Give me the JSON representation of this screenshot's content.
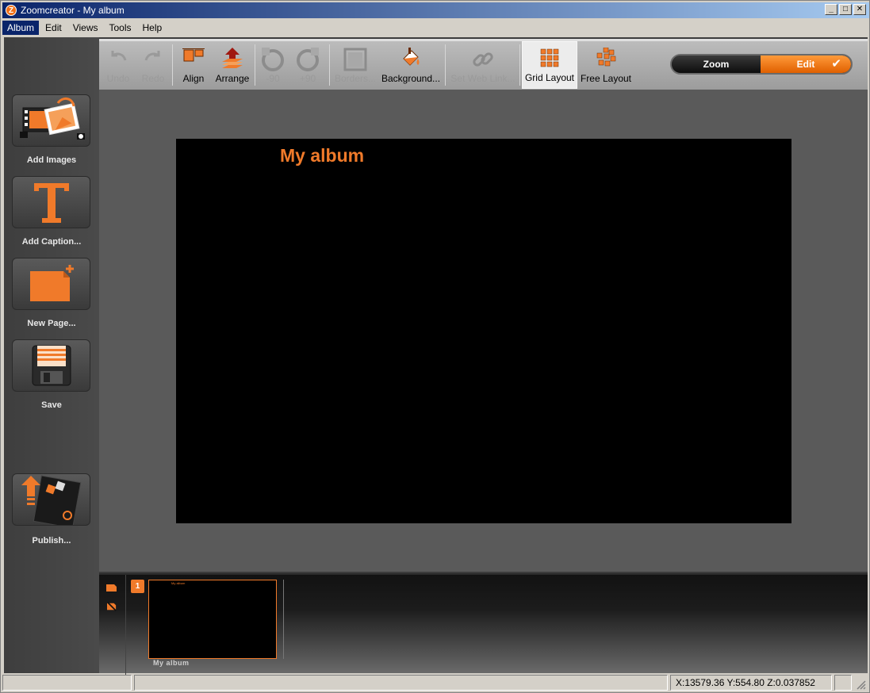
{
  "window": {
    "app_icon": "Z",
    "title": "Zoomcreator - My album",
    "buttons": [
      "_",
      "□",
      "✕"
    ]
  },
  "menubar": [
    "Album",
    "Edit",
    "Views",
    "Tools",
    "Help"
  ],
  "leftbar": {
    "tools": [
      {
        "label": "Add Images",
        "icon": "add-images-icon"
      },
      {
        "label": "Add Caption...",
        "icon": "caption-t-icon"
      },
      {
        "label": "New Page...",
        "icon": "new-page-icon"
      },
      {
        "label": "Save",
        "icon": "floppy-save-icon"
      },
      {
        "label": "Publish...",
        "icon": "publish-icon"
      }
    ]
  },
  "toolbar": {
    "undo": "Undo",
    "redo": "Redo",
    "align": "Align",
    "arrange": "Arrange",
    "rotate_ccw": "-90",
    "rotate_cw": "+90",
    "borders": "Borders...",
    "background": "Background...",
    "set_web_link": "Set Web Link...",
    "grid_layout": "Grid Layout",
    "free_layout": "Free Layout",
    "mode_zoom": "Zoom",
    "mode_edit": "Edit"
  },
  "canvas": {
    "page_title": "My album"
  },
  "filmstrip": {
    "page_number": "1",
    "thumb_title": "My album",
    "thumb_caption": "My album"
  },
  "statusbar": {
    "cell1": "",
    "cell2": "",
    "coords": "X:13579.36 Y:554.80 Z:0.037852",
    "cell4": ""
  },
  "colors": {
    "accent": "#f07a2a",
    "titlebar": "#0a246a"
  }
}
